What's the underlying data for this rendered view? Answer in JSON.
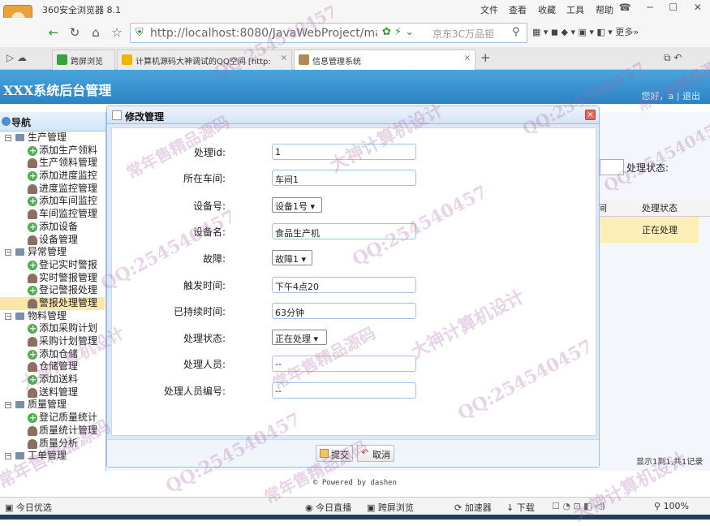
{
  "browser": {
    "name": "360安全浏览器 8.1",
    "menu": [
      "文件",
      "查看",
      "收藏",
      "工具",
      "帮助"
    ],
    "url": "http://localhost:8080/JavaWebProject/main.j",
    "search_placeholder": "京东3C万品钜",
    "more_label": "更多»",
    "tabs": [
      {
        "title": "跨屏浏览",
        "active": false
      },
      {
        "title": "计算机源码大神调试的QQ空间 [http:",
        "active": false
      },
      {
        "title": "信息管理系统",
        "active": true
      }
    ]
  },
  "header": {
    "title": "XXX系统后台管理",
    "user_text": "您好，a | 退出"
  },
  "nav": {
    "title": "导航",
    "groups": [
      {
        "label": "生产管理",
        "items": [
          {
            "label": "添加生产领料",
            "icon": "add"
          },
          {
            "label": "生产领料管理",
            "icon": "user"
          },
          {
            "label": "添加进度监控",
            "icon": "add"
          },
          {
            "label": "进度监控管理",
            "icon": "user"
          },
          {
            "label": "添加车间监控",
            "icon": "add"
          },
          {
            "label": "车间监控管理",
            "icon": "user"
          },
          {
            "label": "添加设备",
            "icon": "add"
          },
          {
            "label": "设备管理",
            "icon": "user"
          }
        ]
      },
      {
        "label": "异常管理",
        "items": [
          {
            "label": "登记实时警报",
            "icon": "add"
          },
          {
            "label": "实时警报管理",
            "icon": "user"
          },
          {
            "label": "登记警报处理",
            "icon": "add"
          },
          {
            "label": "警报处理管理",
            "icon": "user",
            "selected": true
          }
        ]
      },
      {
        "label": "物料管理",
        "items": [
          {
            "label": "添加采购计划",
            "icon": "add"
          },
          {
            "label": "采购计划管理",
            "icon": "user"
          },
          {
            "label": "添加仓储",
            "icon": "add"
          },
          {
            "label": "仓储管理",
            "icon": "user"
          },
          {
            "label": "添加送料",
            "icon": "add"
          },
          {
            "label": "送料管理",
            "icon": "user"
          }
        ]
      },
      {
        "label": "质量管理",
        "items": [
          {
            "label": "登记质量统计",
            "icon": "add"
          },
          {
            "label": "质量统计管理",
            "icon": "user"
          },
          {
            "label": "质量分析",
            "icon": "user"
          }
        ]
      },
      {
        "label": "工单管理",
        "items": []
      }
    ]
  },
  "background_grid": {
    "filter_label": "处理状态:",
    "columns": [
      "间",
      "处理状态"
    ],
    "row_status": "正在处理",
    "pager": "显示1到1,共1记录"
  },
  "dialog": {
    "title": "修改管理",
    "fields": [
      {
        "label": "处理id:",
        "value": "1",
        "kind": "input"
      },
      {
        "label": "所在车间:",
        "value": "车间1",
        "kind": "input"
      },
      {
        "label": "设备号:",
        "value": "设备1号 ▾",
        "kind": "select"
      },
      {
        "label": "设备名:",
        "value": "食品生产机",
        "kind": "input"
      },
      {
        "label": "故障:",
        "value": "故障1 ▾",
        "kind": "select"
      },
      {
        "label": "触发时间:",
        "value": "下午4点20",
        "kind": "input"
      },
      {
        "label": "已持续时间:",
        "value": "63分钟",
        "kind": "input"
      },
      {
        "label": "处理状态:",
        "value": "正在处理 ▾",
        "kind": "select"
      },
      {
        "label": "处理人员:",
        "value": "--",
        "kind": "input"
      },
      {
        "label": "处理人员编号:",
        "value": "--",
        "kind": "input"
      }
    ],
    "submit_label": "提交",
    "cancel_label": "取消"
  },
  "footer": "© Powered by dashen",
  "statusbar": {
    "left": "今日优选",
    "items": [
      "今日直播",
      "跨屏浏览",
      "加速器",
      "下载"
    ],
    "zoom": "100%"
  },
  "watermarks": [
    "QQ:254540457",
    "大神计算机设计",
    "常年售精品源码"
  ]
}
